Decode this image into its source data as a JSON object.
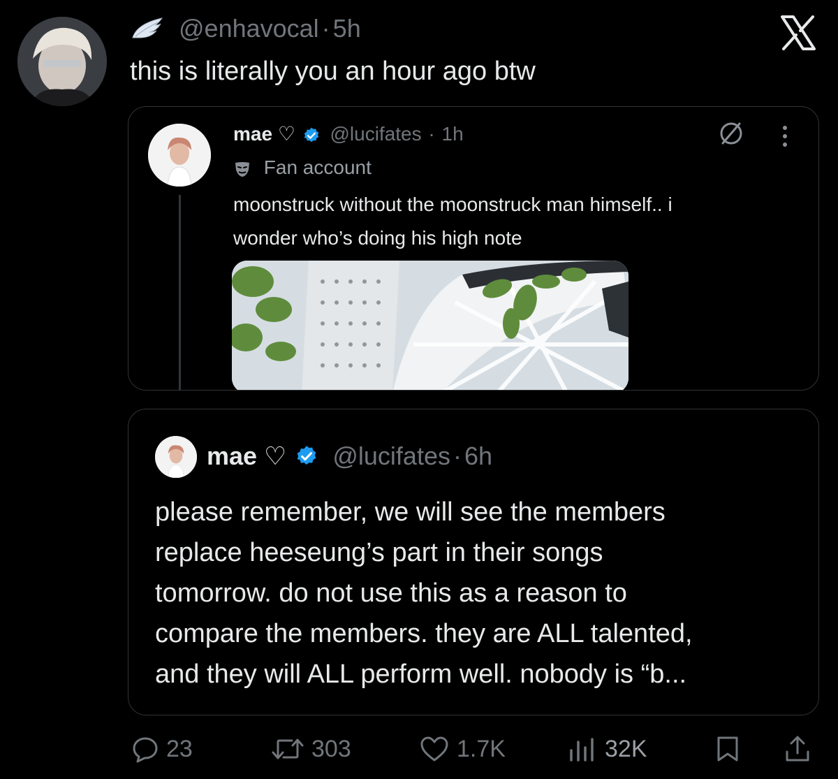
{
  "tweet": {
    "handle": "@enhavocal",
    "time": "5h",
    "dot": "·",
    "text": "this is literally you an hour ago btw"
  },
  "quote1": {
    "display_name": "mae ♡",
    "handle": "@lucifates",
    "time": "1h",
    "dot": "·",
    "label": "Fan account",
    "text_line1": "moonstruck without the moonstruck man himself.. i",
    "text_line2": "wonder who’s doing his high note"
  },
  "quote2": {
    "display_name": "mae ♡",
    "handle": "@lucifates",
    "time": "6h",
    "dot": "·",
    "lines": [
      "please remember, we will see the members",
      "replace heeseung’s part in their songs",
      "tomorrow. do not use this as a reason to",
      "compare the members. they are ALL talented,",
      "and they will ALL perform well. nobody is “b..."
    ]
  },
  "actions": {
    "replies": "23",
    "reposts": "303",
    "likes": "1.7K",
    "views": "32K"
  },
  "colors": {
    "background": "#000000",
    "text": "#e7e9ea",
    "muted": "#71767b",
    "border": "#2f3336",
    "verified": "#1d9bf0"
  }
}
